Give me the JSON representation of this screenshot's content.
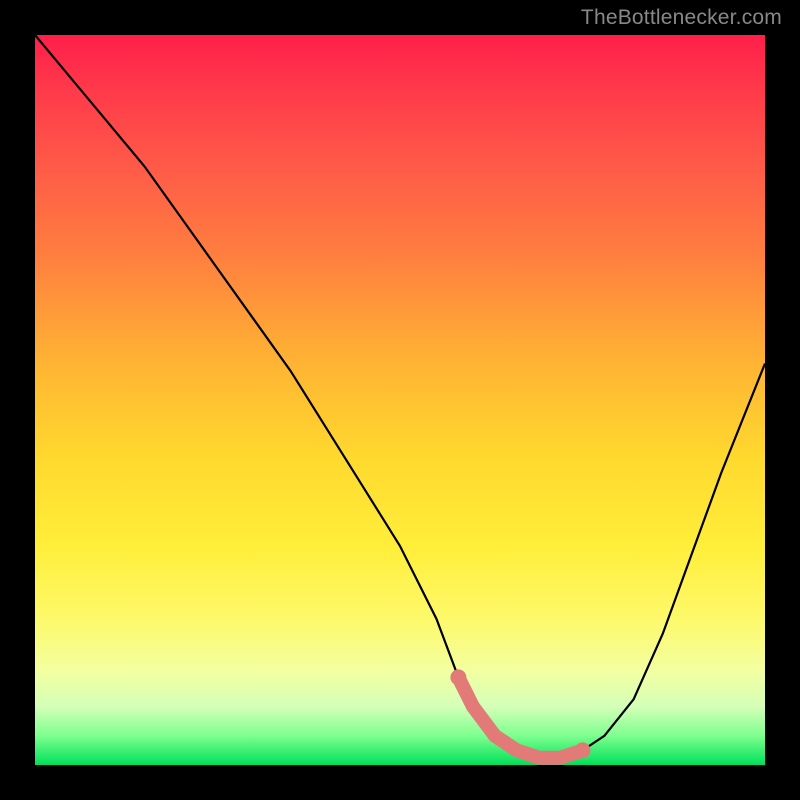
{
  "watermark": "TheBottlenecker.com",
  "chart_data": {
    "type": "line",
    "title": "",
    "xlabel": "",
    "ylabel": "",
    "xlim": [
      0,
      100
    ],
    "ylim": [
      0,
      100
    ],
    "series": [
      {
        "name": "bottleneck-curve",
        "x": [
          0,
          5,
          10,
          15,
          20,
          25,
          30,
          35,
          40,
          45,
          50,
          55,
          58,
          60,
          63,
          66,
          69,
          72,
          75,
          78,
          82,
          86,
          90,
          94,
          100
        ],
        "values": [
          100,
          94,
          88,
          82,
          75,
          68,
          61,
          54,
          46,
          38,
          30,
          20,
          12,
          8,
          4,
          2,
          1,
          1,
          2,
          4,
          9,
          18,
          29,
          40,
          55
        ]
      },
      {
        "name": "highlight-band",
        "x": [
          58,
          60,
          63,
          66,
          69,
          72,
          75
        ],
        "values": [
          12,
          8,
          4,
          2,
          1,
          1,
          2
        ]
      }
    ],
    "colors": {
      "curve": "#000000",
      "highlight": "#e27a78",
      "gradient_top": "#ff1f4a",
      "gradient_mid": "#ffd92e",
      "gradient_bottom": "#00e05a"
    }
  }
}
